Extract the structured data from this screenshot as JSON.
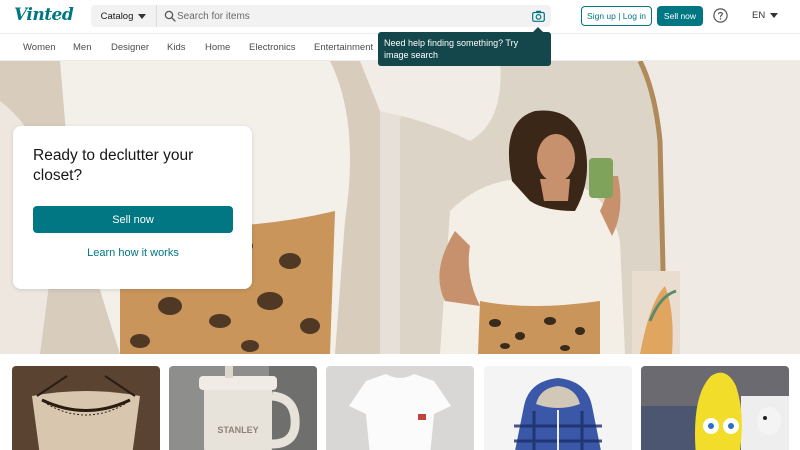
{
  "header": {
    "logo": "Vinted",
    "catalog_label": "Catalog",
    "search_placeholder": "Search for items",
    "signup_label": "Sign up | Log in",
    "sell_label": "Sell now",
    "language_label": "EN"
  },
  "categories": [
    "Women",
    "Men",
    "Designer",
    "Kids",
    "Home",
    "Electronics",
    "Entertainment"
  ],
  "tooltip": {
    "text": "Need help finding something? Try image search"
  },
  "hero": {
    "title": "Ready to declutter your closet?",
    "sell_label": "Sell now",
    "learn_label": "Learn how it works"
  },
  "items": [
    {
      "icon": "lace-top-photo"
    },
    {
      "icon": "stanley-cup-photo"
    },
    {
      "icon": "white-tshirt-photo"
    },
    {
      "icon": "plaid-hoodie-photo"
    },
    {
      "icon": "spongebob-plush-photo"
    }
  ],
  "colors": {
    "brand": "#007782",
    "tooltip": "#13474c"
  }
}
